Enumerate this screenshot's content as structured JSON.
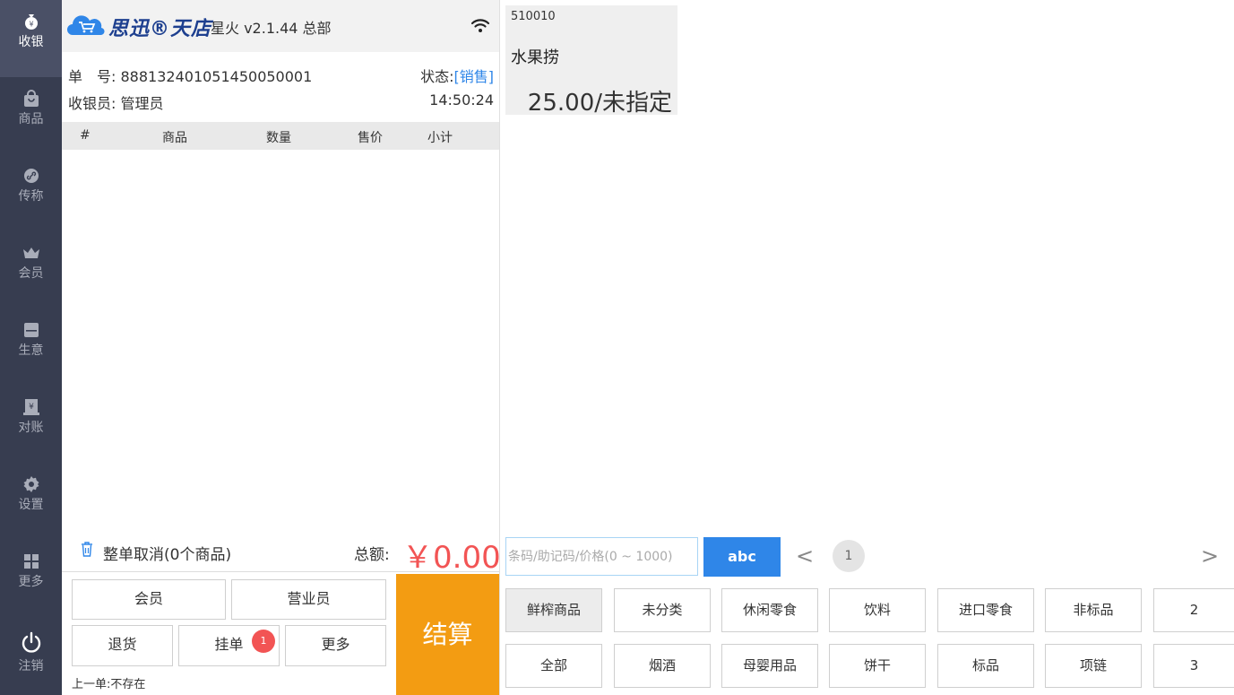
{
  "sidebar": {
    "items": [
      {
        "label": "收银",
        "icon": "money-bag-icon"
      },
      {
        "label": "商品",
        "icon": "shopping-bag-icon"
      },
      {
        "label": "传称",
        "icon": "link-icon"
      },
      {
        "label": "会员",
        "icon": "crown-icon"
      },
      {
        "label": "生意",
        "icon": "report-icon"
      },
      {
        "label": "对账",
        "icon": "ledger-icon"
      },
      {
        "label": "设置",
        "icon": "gear-icon"
      },
      {
        "label": "更多",
        "icon": "grid-icon"
      },
      {
        "label": "注销",
        "icon": "power-icon"
      }
    ]
  },
  "header": {
    "brand": "思迅®天店",
    "version": "星火 v2.1.44 总部"
  },
  "order": {
    "number_label": "单　号:",
    "number": "888132401051450050001",
    "status_label": "状态:",
    "status": "[销售]",
    "cashier_label": "收银员:",
    "cashier": "管理员",
    "time": "14:50:24"
  },
  "table": {
    "columns": [
      "#",
      "商品",
      "数量",
      "售价",
      "小计"
    ]
  },
  "summary": {
    "cancel_label": "整单取消(0个商品)",
    "total_label": "总额:",
    "total_value": "￥0.00"
  },
  "actions": {
    "member": "会员",
    "salesperson": "营业员",
    "return": "退货",
    "hold": "挂单",
    "hold_badge": "1",
    "more": "更多",
    "checkout": "结算",
    "last_order": "上一单:不存在"
  },
  "product": {
    "code": "510010",
    "name": "水果捞",
    "price": "25.00/未指定"
  },
  "search": {
    "placeholder": "条码/助记码/价格(0 ~ 1000)",
    "keyboard_label": "abc",
    "page": "1",
    "prev": "<",
    "next": ">"
  },
  "categories": {
    "row1": [
      "鲜榨商品",
      "未分类",
      "休闲零食",
      "饮料",
      "进口零食",
      "非标品",
      "2"
    ],
    "row2": [
      "全部",
      "烟酒",
      "母婴用品",
      "饼干",
      "标品",
      "项链",
      "3"
    ]
  },
  "colors": {
    "sidebar_bg": "#373d50",
    "accent_blue": "#2f86e8",
    "checkout_orange": "#f39c12",
    "total_red": "#f25454"
  }
}
